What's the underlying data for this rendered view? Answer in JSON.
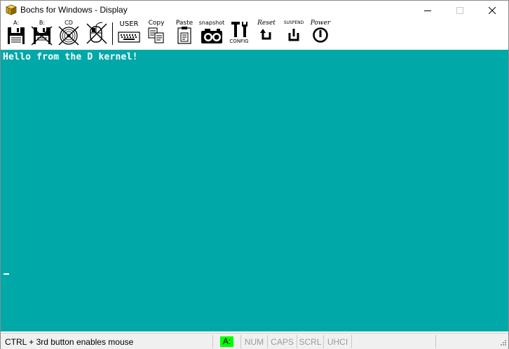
{
  "window": {
    "title": "Bochs for Windows - Display",
    "app_icon": "bochs-cube-icon"
  },
  "toolbar": {
    "floppy_a_label": "A:",
    "floppy_b_label": "B:",
    "cdrom_label": "CD",
    "mouse_icon": "mouse-disabled-icon",
    "user_label": "USER",
    "copy_label": "Copy",
    "paste_label": "Paste",
    "snapshot_label": "snapshot",
    "config_label": "CONFIG",
    "reset_label": "Reset",
    "suspend_label": "SUSPEND",
    "power_label": "Power"
  },
  "display": {
    "console_text": "Hello from the D kernel!",
    "background_color": "#00a8a8",
    "text_color": "#ffffff"
  },
  "statusbar": {
    "message": "CTRL + 3rd button enables mouse",
    "drive_indicator": "A:",
    "drive_indicator_color": "#00ff00",
    "indicators": [
      "NUM",
      "CAPS",
      "SCRL",
      "UHCI"
    ]
  }
}
